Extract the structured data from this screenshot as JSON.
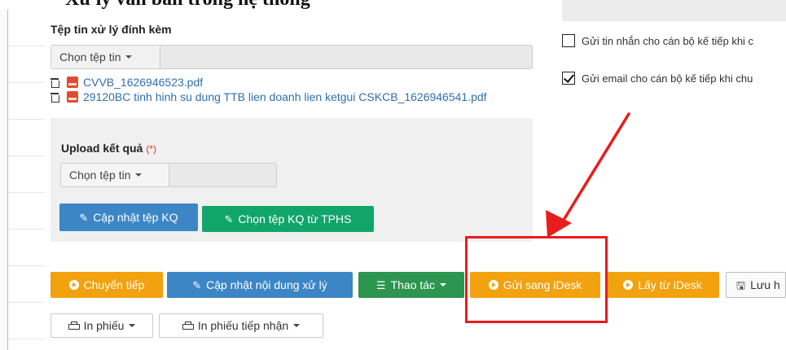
{
  "header": {
    "partial_title": "Xử lý văn bản trong hệ thống"
  },
  "attachments": {
    "title": "Tệp tin xử lý đính kèm",
    "choose_file_label": "Chọn tệp tin",
    "files": [
      {
        "name": "CVVB_1626946523.pdf"
      },
      {
        "name": "29120BC tinh hinh su dung TTB lien doanh lien ketgui CSKCB_1626946541.pdf"
      }
    ]
  },
  "upload": {
    "label": "Upload kết quả",
    "required_mark": "(*)",
    "choose_file_label": "Chọn tệp tin",
    "update_button": "Cập nhật tệp KQ",
    "choose_from_tphs_button": "Chọn tệp KQ từ TPHS"
  },
  "notifications": {
    "sms_label": "Gửi tin nhắn cho cán bộ kế tiếp khi c",
    "sms_checked": false,
    "email_label": "Gửi email cho cán bộ kế tiếp khi chu",
    "email_checked": true
  },
  "actions": {
    "forward": "Chuyển tiếp",
    "update_content": "Cập nhật nội dung xử lý",
    "operations": "Thao tác",
    "send_idesk": "Gửi sang iDesk",
    "get_idesk": "Lấy từ iDesk",
    "save": "Lưu h"
  },
  "print": {
    "print_slip": "In phiếu",
    "print_receipt_slip": "In phiếu tiếp nhận"
  },
  "colors": {
    "primary_blue": "#3d86c6",
    "green": "#11a56a",
    "orange": "#f2a20f",
    "teal_green": "#2c9550",
    "annotation_red": "#ea1c1c"
  }
}
